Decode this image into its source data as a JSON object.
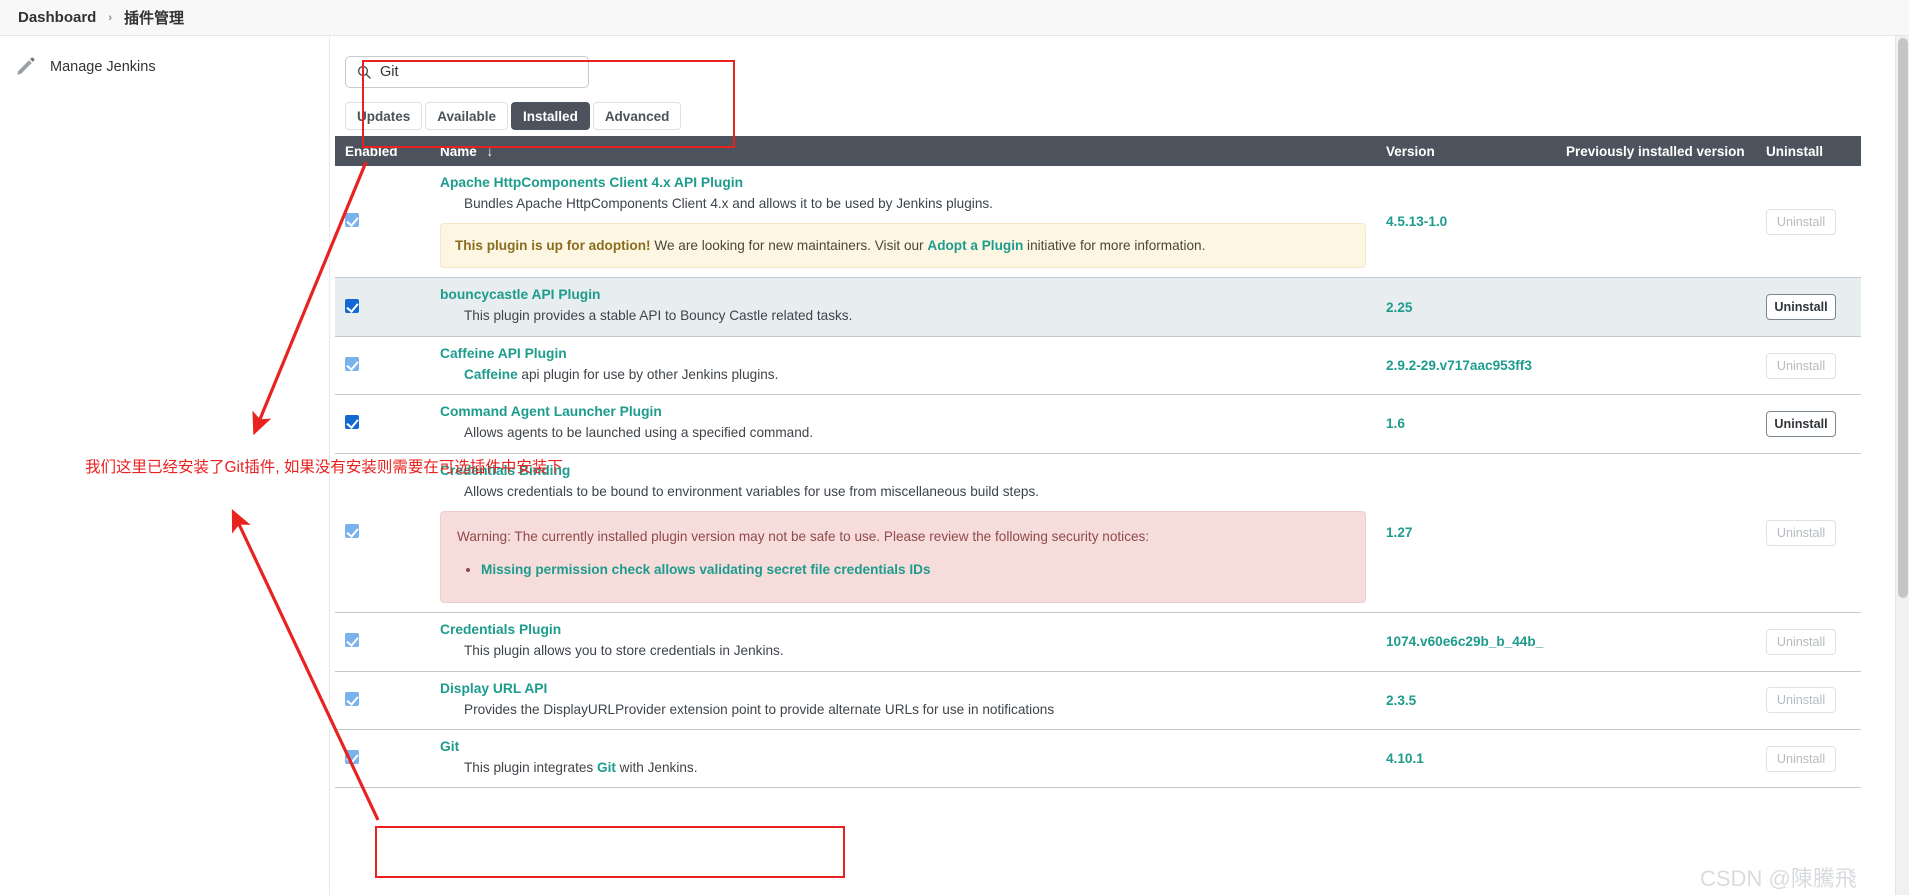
{
  "breadcrumb": {
    "items": [
      "Dashboard",
      "插件管理"
    ],
    "separator": "›"
  },
  "sidebar": {
    "items": [
      {
        "label": "Manage Jenkins",
        "icon": "pencil-icon"
      }
    ]
  },
  "search": {
    "value": "Git",
    "placeholder": "",
    "icon": "search-icon"
  },
  "tabs": [
    {
      "label": "Updates",
      "active": false
    },
    {
      "label": "Available",
      "active": false
    },
    {
      "label": "Installed",
      "active": true
    },
    {
      "label": "Advanced",
      "active": false
    }
  ],
  "table": {
    "columns": [
      "Enabled",
      "Name",
      "Version",
      "Previously installed version",
      "Uninstall"
    ],
    "sort_indicator": "↓",
    "sorted_column": "Name",
    "rows": [
      {
        "enabled": true,
        "checkbox_style": "light",
        "name": "Apache HttpComponents Client 4.x API Plugin",
        "description": "Bundles Apache HttpComponents Client 4.x and allows it to be used by Jenkins plugins.",
        "notice": {
          "type": "adoption",
          "lead": "This plugin is up for adoption!",
          "text_before_link": " We are looking for new maintainers. Visit our ",
          "link": "Adopt a Plugin",
          "text_after_link": " initiative for more information."
        },
        "version": "4.5.13-1.0",
        "previous_version": "",
        "uninstall_label": "Uninstall",
        "uninstall_enabled": false,
        "highlight": false
      },
      {
        "enabled": true,
        "checkbox_style": "strong",
        "name": "bouncycastle API Plugin",
        "description": "This plugin provides a stable API to Bouncy Castle related tasks.",
        "version": "2.25",
        "previous_version": "",
        "uninstall_label": "Uninstall",
        "uninstall_enabled": true,
        "highlight": true
      },
      {
        "enabled": true,
        "checkbox_style": "light",
        "name": "Caffeine API Plugin",
        "description_html_bold": "Caffeine",
        "description": "Caffeine api plugin for use by other Jenkins plugins.",
        "version": "2.9.2-29.v717aac953ff3",
        "previous_version": "",
        "uninstall_label": "Uninstall",
        "uninstall_enabled": false,
        "highlight": false
      },
      {
        "enabled": true,
        "checkbox_style": "strong",
        "name": "Command Agent Launcher Plugin",
        "description": "Allows agents to be launched using a specified command.",
        "version": "1.6",
        "previous_version": "",
        "uninstall_label": "Uninstall",
        "uninstall_enabled": true,
        "highlight": false
      },
      {
        "enabled": true,
        "checkbox_style": "light",
        "name": "Credentials Binding",
        "description": "Allows credentials to be bound to environment variables for use from miscellaneous build steps.",
        "notice": {
          "type": "warning",
          "text": "Warning: The currently installed plugin version may not be safe to use. Please review the following security notices:",
          "bullets": [
            "Missing permission check allows validating secret file credentials IDs"
          ]
        },
        "version": "1.27",
        "previous_version": "",
        "uninstall_label": "Uninstall",
        "uninstall_enabled": false,
        "highlight": false
      },
      {
        "enabled": true,
        "checkbox_style": "light",
        "name": "Credentials Plugin",
        "description": "This plugin allows you to store credentials in Jenkins.",
        "version": "1074.v60e6c29b_b_44b_",
        "previous_version": "",
        "uninstall_label": "Uninstall",
        "uninstall_enabled": false,
        "highlight": false
      },
      {
        "enabled": true,
        "checkbox_style": "light",
        "name": "Display URL API",
        "description": "Provides the DisplayURLProvider extension point to provide alternate URLs for use in notifications",
        "version": "2.3.5",
        "previous_version": "",
        "uninstall_label": "Uninstall",
        "uninstall_enabled": false,
        "highlight": false
      },
      {
        "enabled": true,
        "checkbox_style": "light",
        "name": "Git",
        "description": "This plugin integrates Git with Jenkins.",
        "description_html_bold": "Git",
        "version": "4.10.1",
        "previous_version": "",
        "uninstall_label": "Uninstall",
        "uninstall_enabled": false,
        "highlight": false
      }
    ]
  },
  "annotations": {
    "note_text": "我们这里已经安装了Git插件, 如果没有安装则需要在可选插件中安装下",
    "accent_color": "#e8221f"
  },
  "watermark": {
    "text": "CSDN @陳騰飛",
    "color": "#d9dcdf"
  }
}
